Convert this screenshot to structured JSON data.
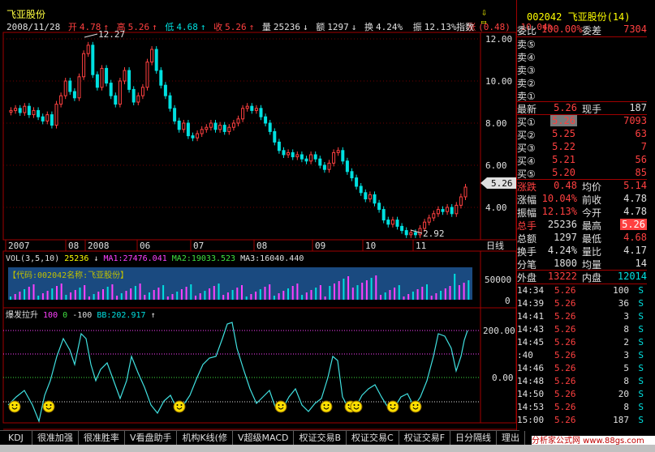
{
  "header": {
    "title": "飞亚股份",
    "date": "2008/11/28",
    "open_label": "开",
    "open": "4.78",
    "high_label": "高",
    "high": "5.26",
    "low_label": "低",
    "low": "4.68",
    "close_label": "收",
    "close": "5.26",
    "volume_label": "量",
    "volume": "25236",
    "amount_label": "额",
    "amount": "1297",
    "turnover_label": "换",
    "turnover": "4.24%",
    "amplitude_label": "振",
    "amplitude": "12.13%",
    "change_label": "涨",
    "change": "(0.48)",
    "change_pct": "10.04%",
    "index_button": "指数"
  },
  "main_chart": {
    "y_ticks": [
      "12.00",
      "10.00",
      "8.00",
      "6.00",
      "4.00"
    ],
    "current_price_tag": "5.26",
    "high_annotation": "12.27",
    "low_annotation": "2.92",
    "x_ticks": [
      "2007",
      "08",
      "2008",
      "06",
      "07",
      "08",
      "09",
      "10",
      "11"
    ],
    "period_label": "日线"
  },
  "volume_panel": {
    "name": "VOL(3,5,10)",
    "vol": "25236",
    "ma1": "MA1:27476.041",
    "ma2": "MA2:19033.523",
    "ma3": "MA3:16040.440",
    "overlay": "【代码:002042名称:飞亚股份】",
    "y_ticks": [
      "50000",
      "0"
    ]
  },
  "indicator_panel": {
    "name": "爆发拉升",
    "p1": "100",
    "p2": "0",
    "p3": "-100",
    "bb": "BB:202.917",
    "y_ticks": [
      "200.00",
      "0.00"
    ]
  },
  "right_panel": {
    "code": "002042",
    "name": "飞亚股份",
    "index_num": "(14)",
    "weibi_label": "委比",
    "weibi": "100.00%",
    "weicha_label": "委差",
    "weicha": "7304",
    "sell": [
      {
        "label": "卖⑤",
        "price": "",
        "vol": ""
      },
      {
        "label": "卖④",
        "price": "",
        "vol": ""
      },
      {
        "label": "卖③",
        "price": "",
        "vol": ""
      },
      {
        "label": "卖②",
        "price": "",
        "vol": ""
      },
      {
        "label": "卖①",
        "price": "",
        "vol": ""
      }
    ],
    "last_label": "最新",
    "last": "5.26",
    "current_hand_label": "现手",
    "current_hand": "187",
    "buy": [
      {
        "label": "买①",
        "price": "5.26",
        "vol": "7093"
      },
      {
        "label": "买②",
        "price": "5.25",
        "vol": "63"
      },
      {
        "label": "买③",
        "price": "5.22",
        "vol": "7"
      },
      {
        "label": "买④",
        "price": "5.21",
        "vol": "56"
      },
      {
        "label": "买⑤",
        "price": "5.20",
        "vol": "85"
      }
    ],
    "stats": [
      {
        "l1": "涨跌",
        "v1": "0.48",
        "l2": "均价",
        "v2": "5.14"
      },
      {
        "l1": "涨幅",
        "v1": "10.04%",
        "l2": "前收",
        "v2": "4.78"
      },
      {
        "l1": "振幅",
        "v1": "12.13%",
        "l2": "今开",
        "v2": "4.78"
      },
      {
        "l1": "总手",
        "v1": "25236",
        "l2": "最高",
        "v2": "5.26"
      },
      {
        "l1": "总额",
        "v1": "1297",
        "l2": "最低",
        "v2": "4.68"
      },
      {
        "l1": "换手",
        "v1": "4.24%",
        "l2": "量比",
        "v2": "4.17"
      },
      {
        "l1": "分笔",
        "v1": "1800",
        "l2": "均量",
        "v2": "14"
      }
    ],
    "outer_label": "外盘",
    "outer": "13222",
    "inner_label": "内盘",
    "inner": "12014",
    "ticks": [
      {
        "time": "14:34",
        "price": "5.26",
        "vol": "100",
        "side": "S"
      },
      {
        "time": "14:39",
        "price": "5.26",
        "vol": "36",
        "side": "S"
      },
      {
        "time": "14:41",
        "price": "5.26",
        "vol": "3",
        "side": "S"
      },
      {
        "time": "14:43",
        "price": "5.26",
        "vol": "8",
        "side": "S"
      },
      {
        "time": "14:45",
        "price": "5.26",
        "vol": "2",
        "side": "S"
      },
      {
        "time": ":40",
        "price": "5.26",
        "vol": "3",
        "side": "S"
      },
      {
        "time": "14:46",
        "price": "5.26",
        "vol": "5",
        "side": "S"
      },
      {
        "time": "14:48",
        "price": "5.26",
        "vol": "8",
        "side": "S"
      },
      {
        "time": "14:50",
        "price": "5.26",
        "vol": "20",
        "side": "S"
      },
      {
        "time": "14:53",
        "price": "5.26",
        "vol": "8",
        "side": "S"
      },
      {
        "time": "15:00",
        "price": "5.26",
        "vol": "187",
        "side": "S"
      }
    ]
  },
  "tabs": [
    "KDJ",
    "很准加强",
    "很准胜率",
    "V看盘助手",
    "机构K线(修",
    "V超级MACD",
    "权证交易B",
    "权证交易C",
    "权证交易F",
    "日分隔线",
    "理出"
  ],
  "watermark": "分析家公式网 www.88gs.com",
  "colors": {
    "up": "#ff4040",
    "down": "#00e0e0",
    "frame": "#a00000"
  }
}
